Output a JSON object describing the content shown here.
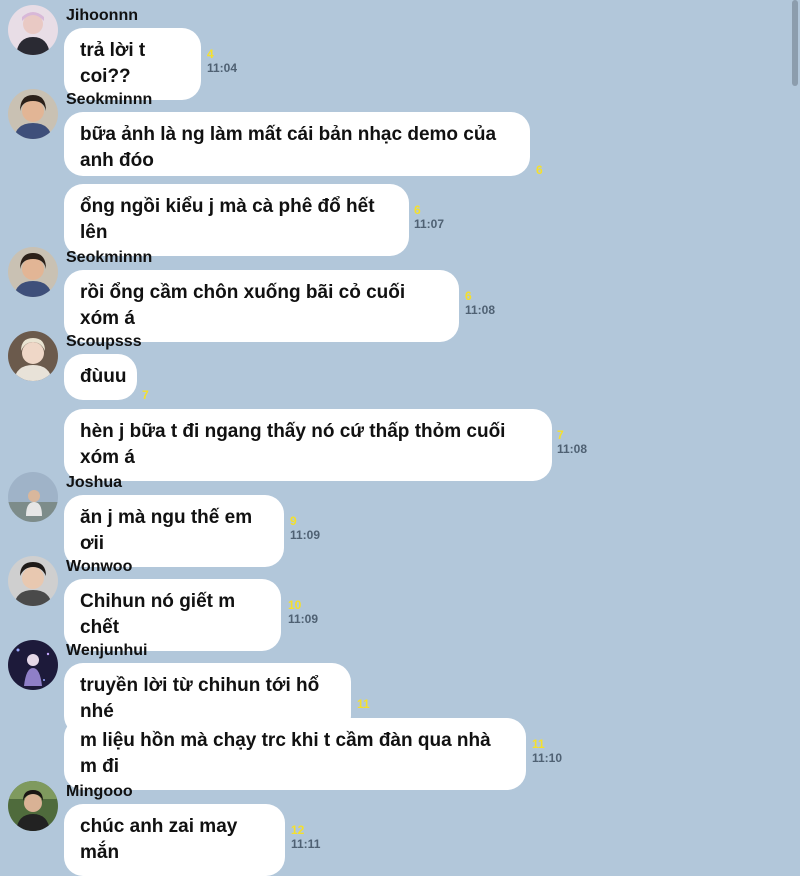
{
  "groups": [
    {
      "sender": "Jihoonnn",
      "avatar_icon": "avatar-jihoonnn-icon",
      "messages": [
        {
          "text": "trả lời t coi??",
          "unread": "4",
          "time": "11:04"
        }
      ]
    },
    {
      "sender": "Seokminnn",
      "avatar_icon": "avatar-seokminnn-icon",
      "messages": [
        {
          "text": "bữa ảnh là ng làm mất cái bản nhạc demo của anh đóo",
          "unread": "6",
          "time": ""
        },
        {
          "text": "ổng ngồi kiểu j mà cà phê đổ hết lên",
          "unread": "6",
          "time": "11:07"
        }
      ]
    },
    {
      "sender": "Seokminnn",
      "avatar_icon": "avatar-seokminnn-icon",
      "messages": [
        {
          "text": "rồi ổng cầm chôn xuống bãi cỏ cuối xóm á",
          "unread": "6",
          "time": "11:08"
        }
      ]
    },
    {
      "sender": "Scoupsss",
      "avatar_icon": "avatar-scoupsss-icon",
      "messages": [
        {
          "text": "đùuu",
          "unread": "7",
          "time": ""
        },
        {
          "text": "hèn j bữa t đi ngang thấy nó cứ thấp thỏm cuối xóm á",
          "unread": "7",
          "time": "11:08"
        }
      ]
    },
    {
      "sender": "Joshua",
      "avatar_icon": "avatar-joshua-icon",
      "messages": [
        {
          "text": "ăn j mà ngu thế em ơii",
          "unread": "9",
          "time": "11:09"
        }
      ]
    },
    {
      "sender": "Wonwoo",
      "avatar_icon": "avatar-wonwoo-icon",
      "messages": [
        {
          "text": "Chihun nó giết m chết",
          "unread": "10",
          "time": "11:09"
        }
      ]
    },
    {
      "sender": "Wenjunhui",
      "avatar_icon": "avatar-wenjunhui-icon",
      "messages": [
        {
          "text": "truyền lời từ chihun tới hổ nhé",
          "unread": "11",
          "time": ""
        },
        {
          "text": "m liệu hồn mà chạy trc khi t cầm đàn qua nhà m đi",
          "unread": "11",
          "time": "11:10"
        }
      ]
    },
    {
      "sender": "Mingooo",
      "avatar_icon": "avatar-mingooo-icon",
      "messages": [
        {
          "text": "chúc anh zai may mắn",
          "unread": "12",
          "time": "11:11"
        }
      ]
    }
  ],
  "colors": {
    "background": "#b2c7da",
    "bubble": "#ffffff",
    "unread": "#f5e02c",
    "time": "#4f6173"
  }
}
